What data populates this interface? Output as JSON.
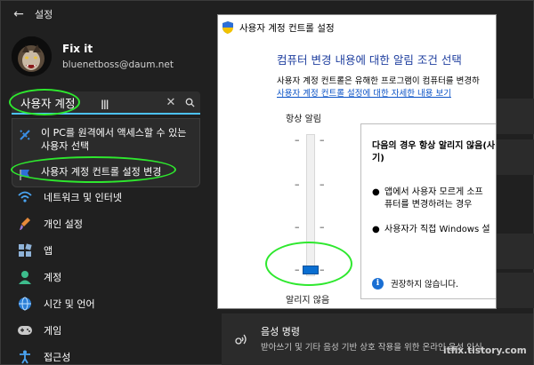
{
  "app": {
    "title": "설정",
    "back_icon": "back-arrow-icon"
  },
  "profile": {
    "name": "Fix it",
    "email": "bluenetboss@daum.net"
  },
  "search": {
    "value": "사용자 계정",
    "clear_icon": "close-icon",
    "search_icon": "search-icon"
  },
  "suggestions": [
    {
      "label_line1": "이 PC를 원격에서 액세스할 수 있는",
      "label_line2": "사용자 선택",
      "icon": "remote-access-icon"
    },
    {
      "label": "사용자 계정 컨트롤 설정 변경",
      "icon": "uac-flag-icon"
    }
  ],
  "nav": [
    {
      "label": "네트워크 및 인터넷",
      "icon": "wifi-icon"
    },
    {
      "label": "개인 설정",
      "icon": "brush-icon"
    },
    {
      "label": "앱",
      "icon": "apps-icon"
    },
    {
      "label": "계정",
      "icon": "person-icon"
    },
    {
      "label": "시간 및 언어",
      "icon": "globe-clock-icon"
    },
    {
      "label": "게임",
      "icon": "gamepad-icon"
    },
    {
      "label": "접근성",
      "icon": "accessibility-icon"
    }
  ],
  "voice_card": {
    "title": "음성 명령",
    "description": "받아쓰기 및 기타 음성 기반 상호 작용을 위한 온라인 음성 인식",
    "icon": "voice-icon"
  },
  "uac": {
    "window_title": "사용자 계정 컨트롤 설정",
    "heading": "컴퓨터 변경 내용에 대한 알림 조건 선택",
    "description": "사용자 계정 컨트롤은 유해한 프로그램이 컴퓨터를 변경하",
    "link": "사용자 계정 컨트롤 설정에 대한 자세한 내용 보기",
    "slider_top_label": "항상 알림",
    "slider_bottom_label": "알리지 않음",
    "slider_level": 0,
    "slider_levels": 4,
    "info_title_line1": "다음의 경우 항상 알리지 않음(사",
    "info_title_line2": "기)",
    "bullets": [
      {
        "line1": "앱에서 사용자 모르게 소프",
        "line2": "퓨터를 변경하려는 경우"
      },
      {
        "line1": "사용자가 직접 Windows 설"
      }
    ],
    "recommendation": "권장하지 않습니다.",
    "info_icon": "info-icon"
  },
  "watermark": "itfix.tistory.com",
  "colors": {
    "highlight": "#2ee82e",
    "accent": "#4cc2ff",
    "uac_heading": "#1f3f9f",
    "slider_thumb": "#0a6ed1"
  }
}
